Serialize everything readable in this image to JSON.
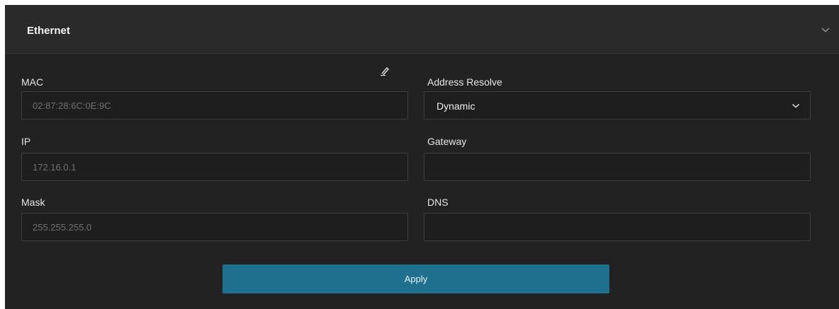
{
  "panel": {
    "title": "Ethernet",
    "collapse_icon": "chevron-down-icon"
  },
  "fields": {
    "mac": {
      "label": "MAC",
      "value": "02:87:28:6C:0E:9C",
      "edit_icon": "pencil-icon"
    },
    "ip": {
      "label": "IP",
      "value": "172.16.0.1"
    },
    "mask": {
      "label": "Mask",
      "value": "255.255.255.0"
    },
    "address_resolve": {
      "label": "Address Resolve",
      "selected": "Dynamic"
    },
    "gateway": {
      "label": "Gateway",
      "value": ""
    },
    "dns": {
      "label": "DNS",
      "value": ""
    }
  },
  "actions": {
    "apply_label": "Apply"
  },
  "colors": {
    "panel_bg": "#222222",
    "header_bg": "#2a2a2a",
    "input_bg": "#1e1e1e",
    "button_bg": "#1f6f8e"
  }
}
